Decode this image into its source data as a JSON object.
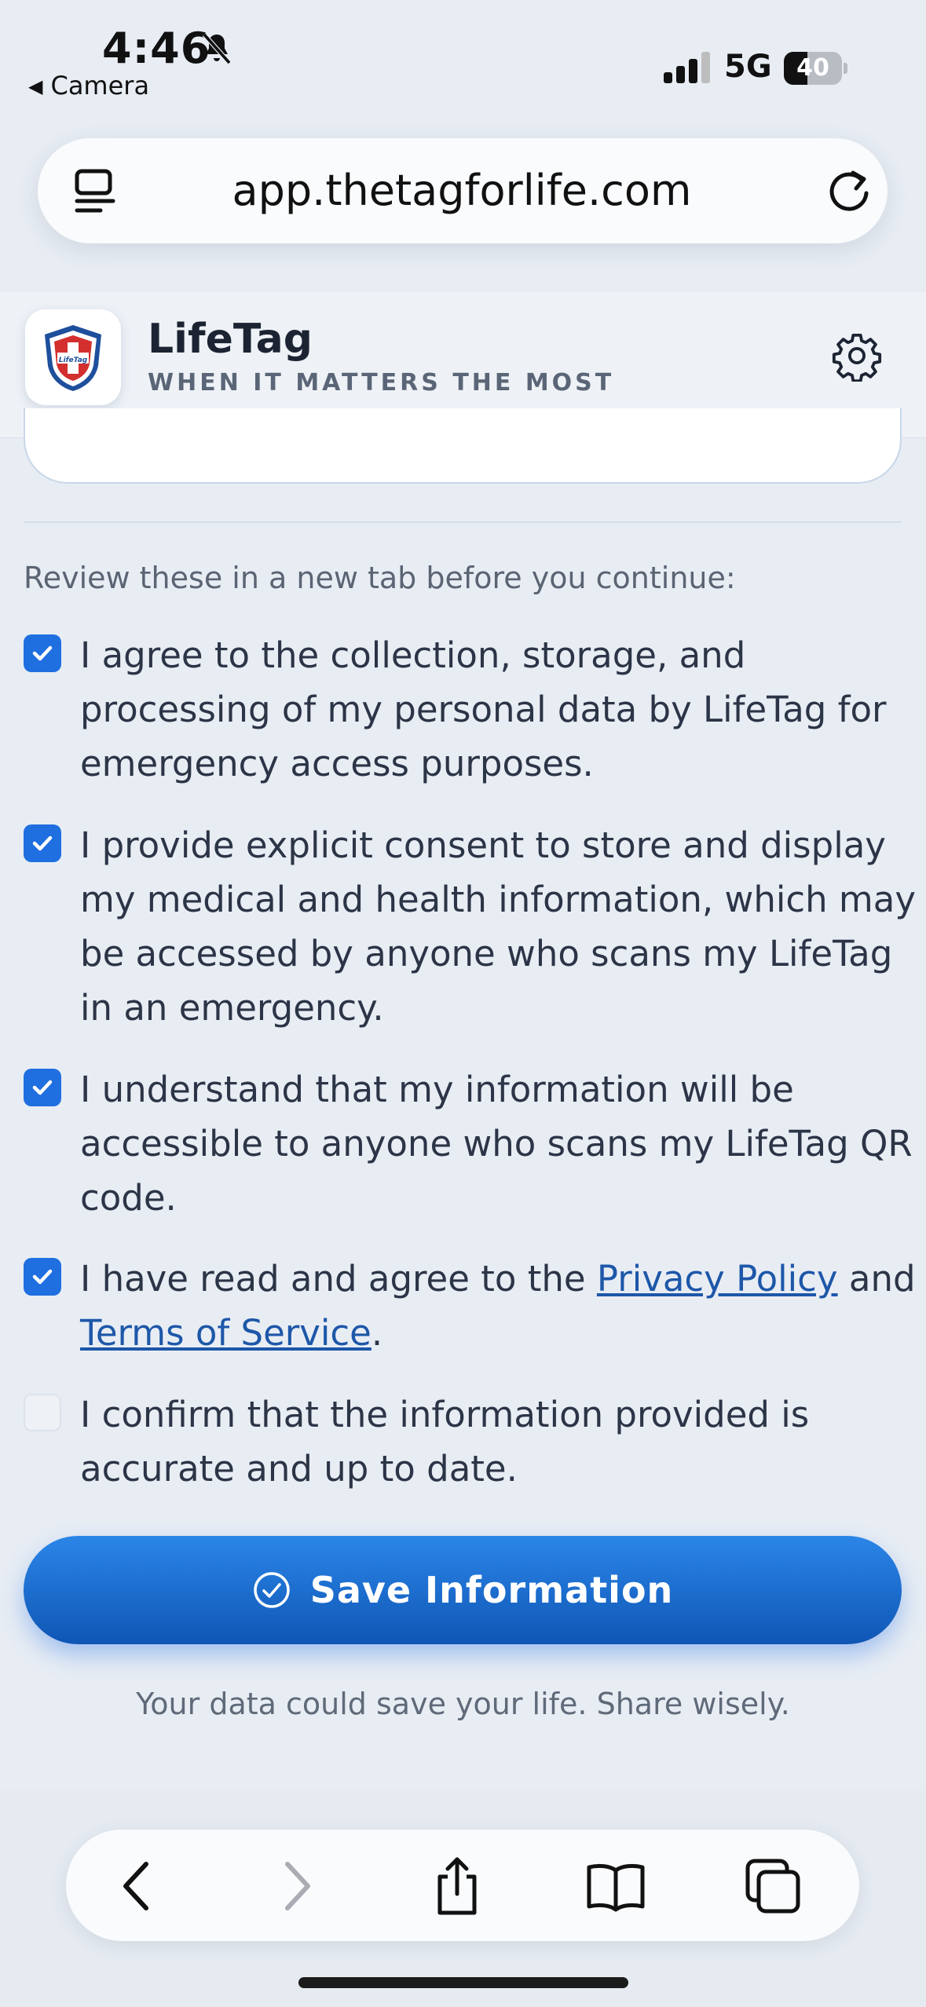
{
  "status_bar": {
    "time": "4:46",
    "back_app": "Camera",
    "network": "5G",
    "battery": "40",
    "battery_level": 0.4
  },
  "browser": {
    "url": "app.thetagforlife.com"
  },
  "app_header": {
    "brand": "LifeTag",
    "tagline": "WHEN IT MATTERS THE MOST",
    "logo_text": "LifeTag"
  },
  "consent": {
    "intro": "Review these in a new tab before you continue:",
    "items": [
      {
        "checked": true,
        "text": "I agree to the collection, storage, and processing of my personal data by LifeTag for emergency access purposes."
      },
      {
        "checked": true,
        "text": "I provide explicit consent to store and display my medical and health information, which may be accessed by anyone who scans my LifeTag in an emergency."
      },
      {
        "checked": true,
        "text": "I understand that my information will be accessible to anyone who scans my LifeTag QR code."
      },
      {
        "checked": true,
        "text_before": "I have read and agree to the ",
        "link1": "Privacy Policy",
        "text_middle": " and ",
        "link2": "Terms of Service",
        "text_after": "."
      },
      {
        "checked": false,
        "text": "I confirm that the information provided is accurate and up to date."
      }
    ]
  },
  "save_button": {
    "label": "Save Information"
  },
  "footer_note": "Your data could save your life. Share wisely.",
  "colors": {
    "accent": "#1f6fe0",
    "button_top": "#2b86e8",
    "button_bottom": "#0f56b5",
    "link": "#1d57a8",
    "page_bg": "#e8edf4"
  }
}
